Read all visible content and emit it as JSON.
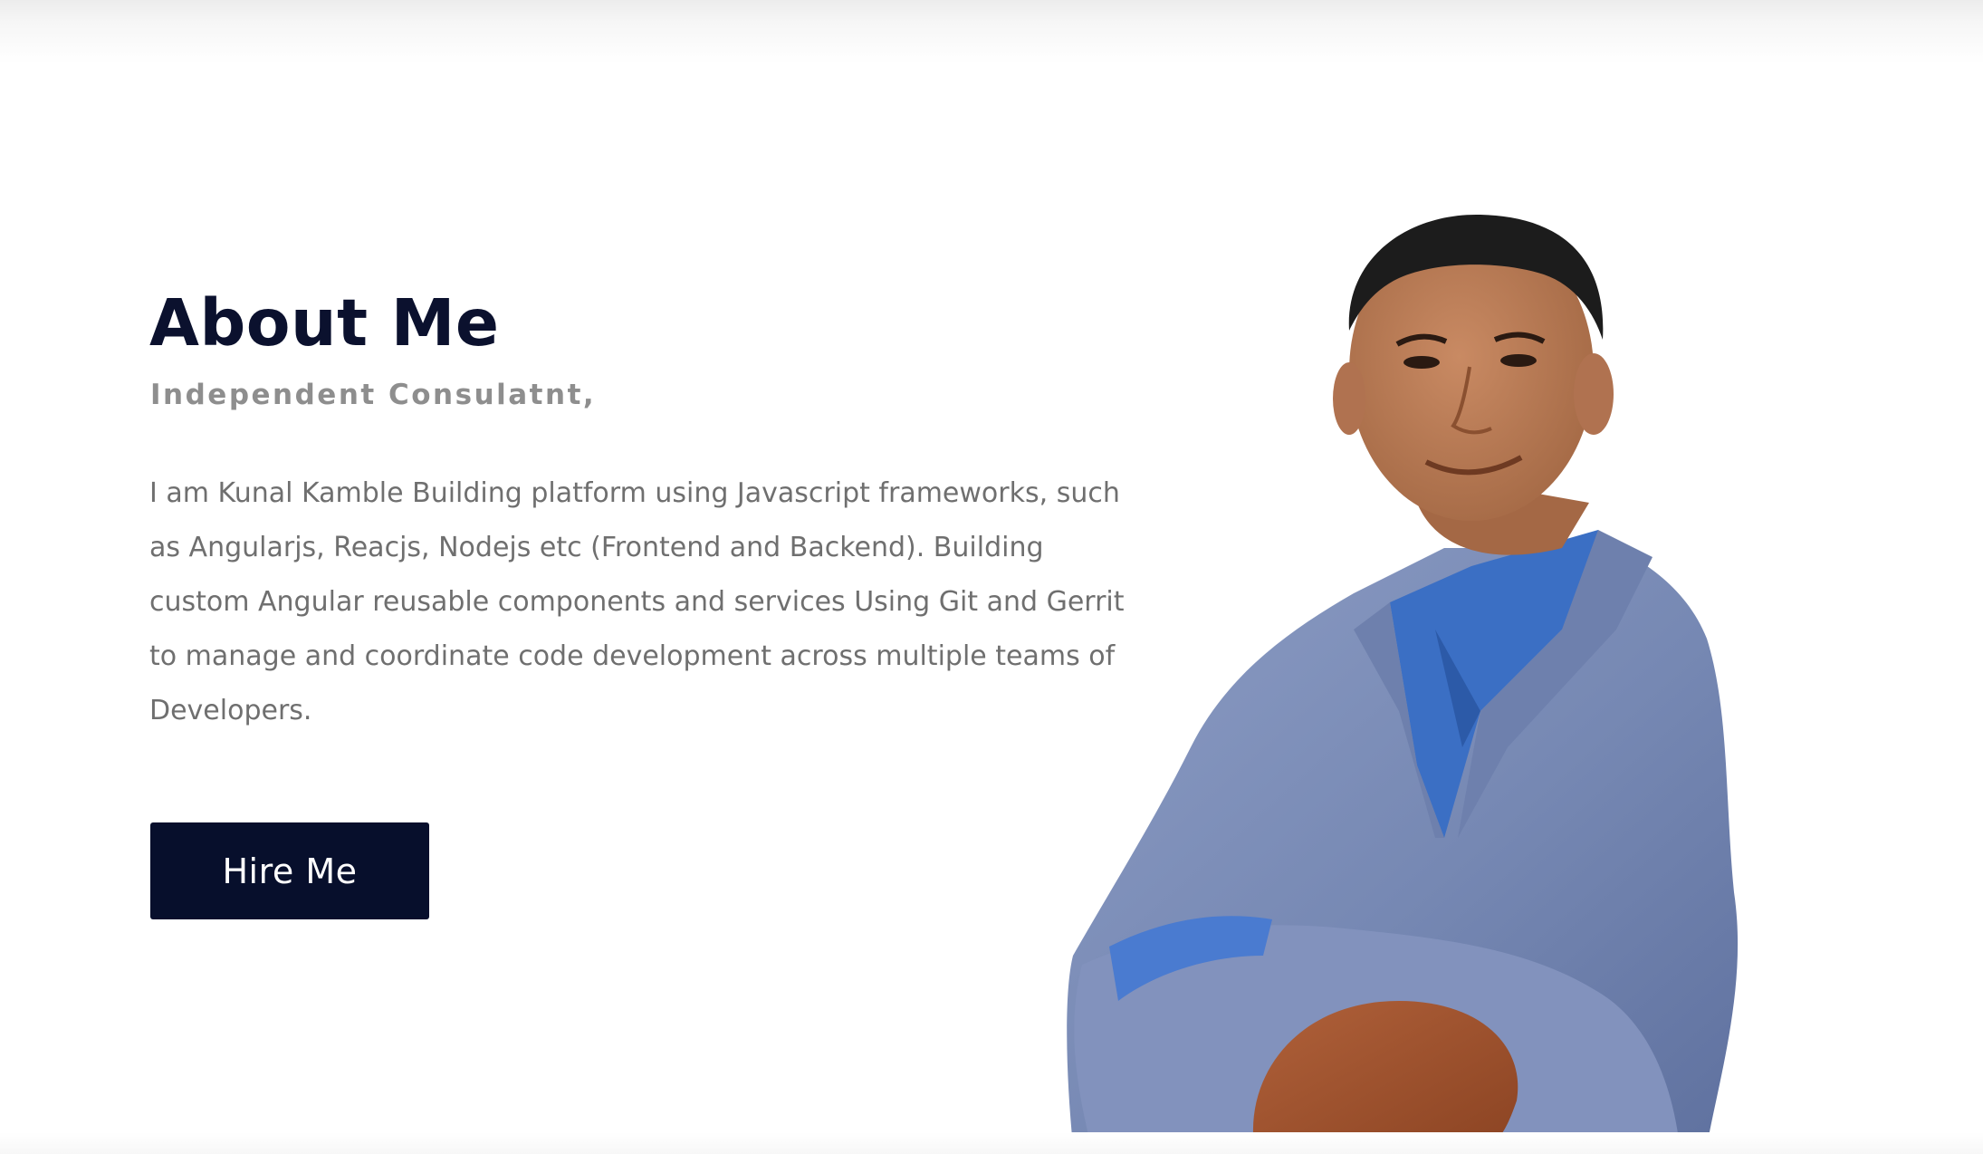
{
  "about": {
    "title": "About Me",
    "subtitle": "Independent Consulatnt,",
    "body": "I am Kunal Kamble Building platform using Javascript frameworks, such as Angularjs, Reacjs, Nodejs etc (Frontend and Backend). Building custom Angular reusable components and services Using Git and Gerrit to manage and coordinate code development across multiple teams of Developers.",
    "hire_button_label": "Hire Me"
  },
  "colors": {
    "title": "#0b112e",
    "subtitle": "#8e8e8e",
    "body_text": "#6f6f6f",
    "button_bg": "#070f2c",
    "button_text": "#ffffff",
    "jacket": "#7d8fb8",
    "elbow_patch": "#a3552e",
    "shirt": "#3b6fc4",
    "skin": "#b87a55",
    "hair": "#1c1c1c"
  },
  "portrait": {
    "icon": "person-portrait"
  }
}
